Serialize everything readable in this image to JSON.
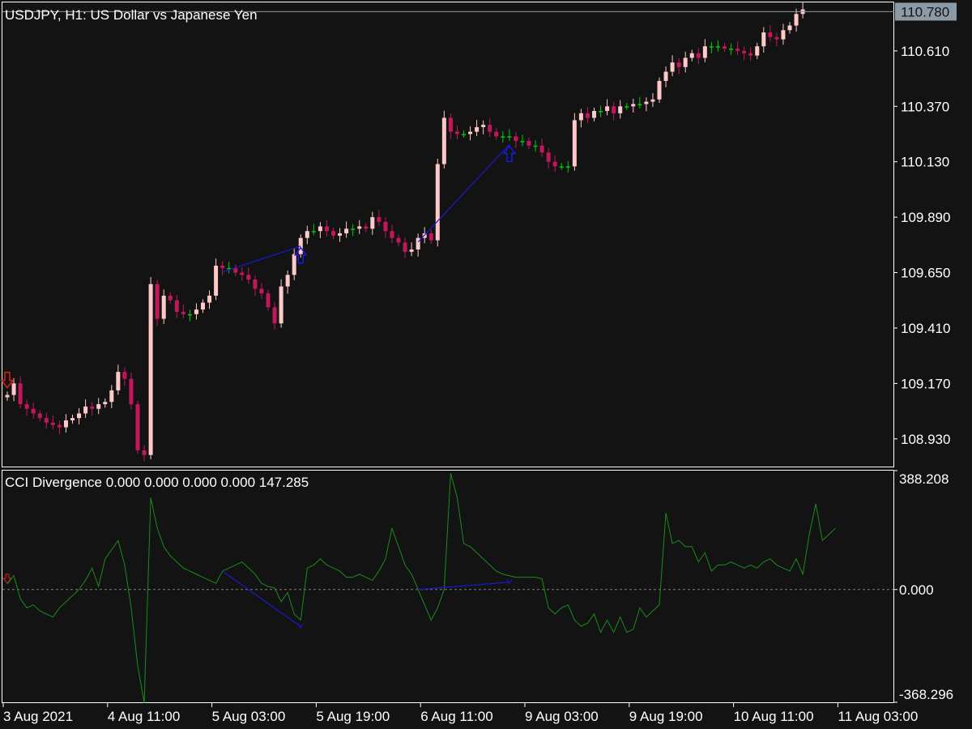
{
  "price_chart": {
    "title": "USDJPY, H1:  US Dollar vs Japanese Yen",
    "current_price_label": "110.780",
    "colors": {
      "bull": "#ffc9c9",
      "bear": "#c2185b",
      "doji": "#00cc00",
      "background": "#131313",
      "axis": "#ffffff",
      "current_line": "#8c9aa6"
    }
  },
  "indicator_panel": {
    "title": "CCI Divergence 0.000 0.000 0.000 0.000 147.285",
    "colors": {
      "line": "#1a8c1a",
      "divergence": "#1a1acc",
      "zero_line": "#808080"
    }
  },
  "chart_data": [
    {
      "type": "candlestick",
      "title": "USDJPY, H1:  US Dollar vs Japanese Yen",
      "ylim": [
        108.81,
        110.82
      ],
      "yticks": [
        "110.610",
        "110.370",
        "110.130",
        "109.890",
        "109.650",
        "109.410",
        "109.170",
        "108.930"
      ],
      "xticks": [
        "3 Aug 2021",
        "4 Aug 11:00",
        "5 Aug 03:00",
        "5 Aug 19:00",
        "6 Aug 11:00",
        "9 Aug 03:00",
        "9 Aug 19:00",
        "10 Aug 11:00",
        "11 Aug 03:00"
      ],
      "closes": [
        109.12,
        109.17,
        109.08,
        109.06,
        109.04,
        109.02,
        109.0,
        108.99,
        108.98,
        109.01,
        109.02,
        109.04,
        109.07,
        109.06,
        109.08,
        109.09,
        109.14,
        109.22,
        109.19,
        109.08,
        108.88,
        108.86,
        109.6,
        109.45,
        109.55,
        109.53,
        109.48,
        109.47,
        109.47,
        109.49,
        109.52,
        109.55,
        109.68,
        109.67,
        109.67,
        109.65,
        109.64,
        109.62,
        109.58,
        109.56,
        109.5,
        109.43,
        109.59,
        109.64,
        109.73,
        109.8,
        109.83,
        109.83,
        109.85,
        109.83,
        109.81,
        109.82,
        109.84,
        109.84,
        109.85,
        109.84,
        109.89,
        109.87,
        109.83,
        109.8,
        109.78,
        109.74,
        109.75,
        109.8,
        109.82,
        109.79,
        110.12,
        110.32,
        110.26,
        110.25,
        110.25,
        110.26,
        110.28,
        110.29,
        110.26,
        110.24,
        110.24,
        110.24,
        110.22,
        110.22,
        110.2,
        110.2,
        110.17,
        110.13,
        110.11,
        110.11,
        110.11,
        110.31,
        110.34,
        110.32,
        110.35,
        110.35,
        110.37,
        110.34,
        110.37,
        110.37,
        110.38,
        110.38,
        110.39,
        110.4,
        110.48,
        110.52,
        110.56,
        110.54,
        110.58,
        110.6,
        110.58,
        110.63,
        110.63,
        110.63,
        110.62,
        110.62,
        110.61,
        110.6,
        110.59,
        110.63,
        110.69,
        110.67,
        110.66,
        110.7,
        110.72,
        110.77,
        110.79
      ],
      "cci": [
        18,
        45,
        -30,
        -60,
        -50,
        -70,
        -80,
        -90,
        -60,
        -40,
        -20,
        0,
        30,
        70,
        10,
        100,
        130,
        160,
        80,
        -60,
        -250,
        -370,
        300,
        200,
        140,
        110,
        90,
        70,
        60,
        50,
        40,
        30,
        20,
        60,
        70,
        80,
        90,
        70,
        50,
        20,
        10,
        5,
        -40,
        -10,
        -80,
        -100,
        70,
        80,
        100,
        80,
        70,
        60,
        40,
        40,
        50,
        40,
        30,
        60,
        100,
        200,
        140,
        80,
        50,
        0,
        -50,
        -100,
        -60,
        0,
        380,
        300,
        150,
        140,
        120,
        100,
        80,
        60,
        50,
        45,
        40,
        40,
        40,
        40,
        35,
        -60,
        -80,
        -60,
        -50,
        -100,
        -120,
        -110,
        -80,
        -140,
        -100,
        -140,
        -90,
        -140,
        -130,
        -60,
        -90,
        -70,
        -50,
        250,
        150,
        160,
        140,
        140,
        90,
        120,
        60,
        80,
        80,
        90,
        80,
        70,
        80,
        70,
        90,
        100,
        80,
        70,
        60,
        100,
        50,
        180,
        280,
        160,
        180,
        200
      ],
      "divergences": [
        {
          "kind": "bullish",
          "from_bar": 33,
          "to_bar": 45
        },
        {
          "kind": "bullish",
          "from_bar": 63,
          "to_bar": 77
        }
      ],
      "arrows": [
        {
          "direction": "down",
          "bar": 0,
          "color": "red"
        },
        {
          "direction": "up",
          "bar": 45,
          "color": "blue"
        },
        {
          "direction": "up",
          "bar": 77,
          "color": "blue"
        }
      ]
    },
    {
      "type": "line",
      "title": "CCI Divergence 0.000 0.000 0.000 0.000 147.285",
      "ylim": [
        -368.296,
        388.208
      ],
      "yticks": [
        "388.208",
        "0.000",
        "-368.296"
      ],
      "series": [
        {
          "name": "CCI",
          "values_ref": "chart_data[0].cci"
        }
      ]
    }
  ]
}
